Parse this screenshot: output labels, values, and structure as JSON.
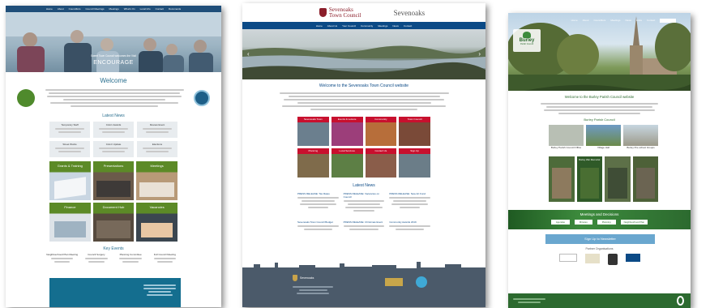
{
  "site1": {
    "nav": [
      "Home",
      "About",
      "Councillors",
      "Council Meetings",
      "Meetings",
      "What's On",
      "Local Info",
      "Contact",
      "Documents"
    ],
    "hero_title": "ENCOURAGE",
    "hero_sub": "Sweet Town Council welcomes the Visit",
    "welcome": "Welcome",
    "latest_news": "Latest News",
    "news": [
      {
        "t": "Temporary Staff",
        "a": "Appointments"
      },
      {
        "t": "CALC Awards",
        "a": "Council wins"
      },
      {
        "t": "Review Event",
        "a": "Parish review"
      },
      {
        "t": "Street Works",
        "a": "Road closures"
      },
      {
        "t": "CALC Update",
        "a": "Training news"
      },
      {
        "t": "Elections",
        "a": "Notice of poll"
      }
    ],
    "tiles": [
      "Grants & Training",
      "Presentations",
      "Meetings",
      "Finance",
      "Document Hub",
      "Vacancies"
    ],
    "events_title": "Key Events",
    "events": [
      "Neighbourhood Plan Meeting",
      "Council Surgery",
      "Planning Committee",
      "Full Council Meeting"
    ]
  },
  "site2": {
    "brand_line1": "Sevenoaks",
    "brand_line2": "Town Council",
    "brand_right": "Sevenoaks",
    "nav": [
      "Home",
      "About Us",
      "Your Council",
      "Community",
      "Meetings",
      "News",
      "Contact"
    ],
    "welcome": "Welcome to the Sevenoaks Town Council website",
    "tiles": [
      "Sevenoaks Town",
      "Events & Leisure",
      "Community",
      "Town Council",
      "Planning",
      "Local Services",
      "Contact Us",
      "Sign Up"
    ],
    "latest_news": "Latest News",
    "news": [
      "PRESS RELEASE: Tax Rates",
      "PRESS RELEASE: Vacancies on Council",
      "PRESS RELEASE: New Art Fund",
      "Sevenoaks Town Council Budget",
      "PRESS RELEASE: Christmas Event",
      "Community Awards 2019"
    ],
    "footer_brand": "Sevenoaks"
  },
  "site3": {
    "logo_line1": "Burley",
    "logo_line2": "Parish Council",
    "nav": [
      "Home",
      "About",
      "Councillors",
      "Meetings",
      "News",
      "Links",
      "Contact"
    ],
    "welcome": "Welcome to the Burley Parish Council website",
    "grid_title": "Burley Parish Council",
    "grid_items": [
      "Burley Parish Council Office",
      "Village Hall",
      "Burley Pre-school Groups",
      "Notice Board",
      "Burley War Memorial",
      "Burley Park",
      "Recreation Ground"
    ],
    "meetings_title": "Meetings and Decisions",
    "meeting_btns": [
      "Agendas",
      "Minutes",
      "Planning",
      "Neighbourhood Plan"
    ],
    "signup": "Sign Up to Newsletter",
    "partners": "Partner Organisations"
  },
  "colors": {
    "s1_nav": "#1f4e79",
    "s1_teal": "#146e8f",
    "s1_green": "#5c8a27",
    "s2_nav": "#0b4a86",
    "s2_footer": "#4b5a6a",
    "s3_nav": "#2c6a2f",
    "s3_green": "#3d8b3d"
  }
}
